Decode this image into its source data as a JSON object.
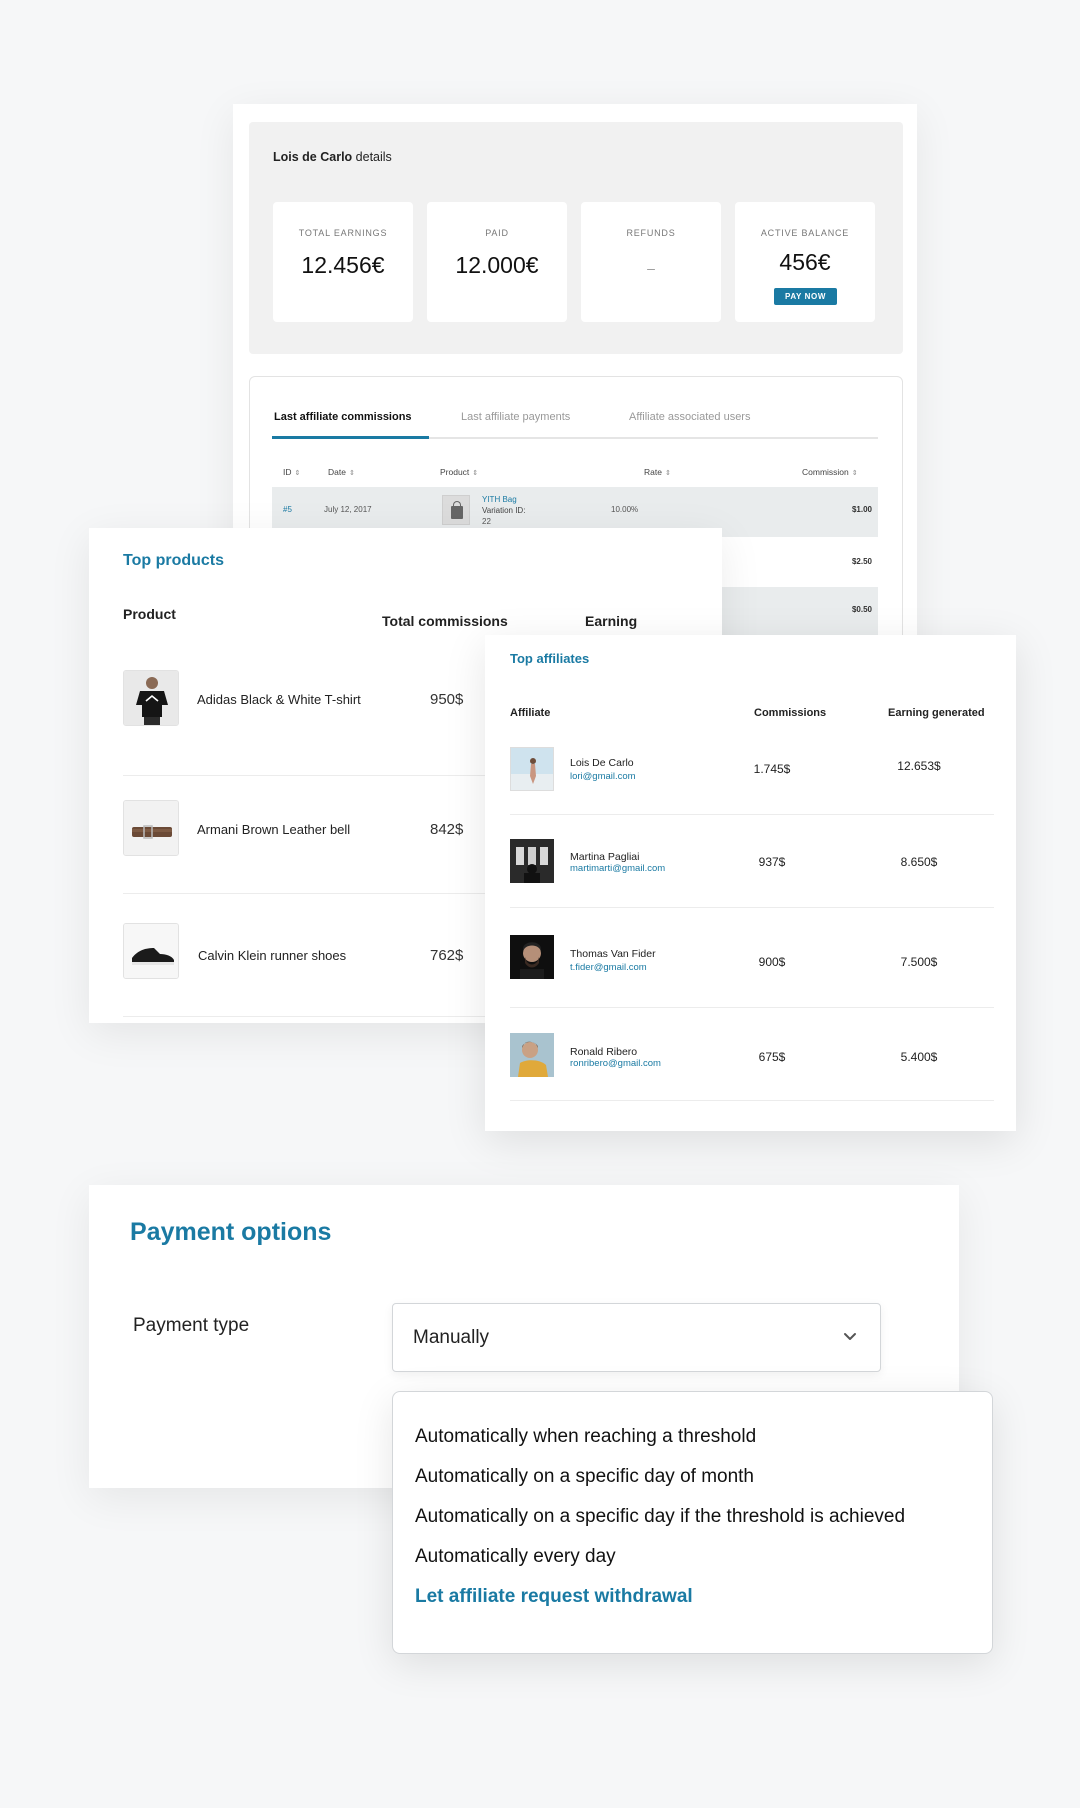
{
  "details": {
    "name": "Lois de Carlo",
    "suffix": " details",
    "stats": [
      {
        "label": "TOTAL EARNINGS",
        "value": "12.456€"
      },
      {
        "label": "PAID",
        "value": "12.000€"
      },
      {
        "label": "REFUNDS",
        "value": "–"
      },
      {
        "label": "ACTIVE BALANCE",
        "value": "456€"
      }
    ],
    "pay_now": "PAY NOW",
    "tabs": [
      "Last affiliate commissions",
      "Last affiliate payments",
      "Affiliate associated users"
    ],
    "columns": [
      "ID",
      "Date",
      "Product",
      "Rate",
      "Commission"
    ],
    "rows": [
      {
        "id": "#5",
        "date": "July 12, 2017",
        "product": "YITH Bag",
        "variation_label": "Variation ID:",
        "variation": "22",
        "rate": "10.00%",
        "commission": "$1.00"
      },
      {
        "commission": "$2.50"
      },
      {
        "commission": "$0.50"
      }
    ]
  },
  "top_products": {
    "title": "Top products",
    "headers": [
      "Product",
      "Total commissions",
      "Earning"
    ],
    "items": [
      {
        "name": "Adidas Black & White T-shirt",
        "commission": "950$"
      },
      {
        "name": "Armani Brown Leather bell",
        "commission": "842$"
      },
      {
        "name": "Calvin Klein runner shoes",
        "commission": "762$"
      }
    ]
  },
  "top_affiliates": {
    "title": "Top affiliates",
    "headers": [
      "Affiliate",
      "Commissions",
      "Earning generated"
    ],
    "items": [
      {
        "name": "Lois De Carlo",
        "email": "lori@gmail.com",
        "commissions": "1.745$",
        "earning": "12.653$"
      },
      {
        "name": "Martina Pagliai",
        "email": "martimarti@gmail.com",
        "commissions": "937$",
        "earning": "8.650$"
      },
      {
        "name": "Thomas Van Fider",
        "email": "t.fider@gmail.com",
        "commissions": "900$",
        "earning": "7.500$"
      },
      {
        "name": "Ronald Ribero",
        "email": "ronribero@gmail.com",
        "commissions": "675$",
        "earning": "5.400$"
      }
    ]
  },
  "payment": {
    "title": "Payment options",
    "type_label": "Payment type",
    "selected": "Manually",
    "options": [
      "Automatically when reaching a threshold",
      "Automatically on a specific day of month",
      "Automatically on a specific day if the threshold is achieved",
      "Automatically every day",
      "Let affiliate request withdrawal"
    ],
    "highlighted_option": "Let affiliate request withdrawal"
  },
  "colors": {
    "accent": "#1a7aa3",
    "background": "#f6f7f8"
  }
}
